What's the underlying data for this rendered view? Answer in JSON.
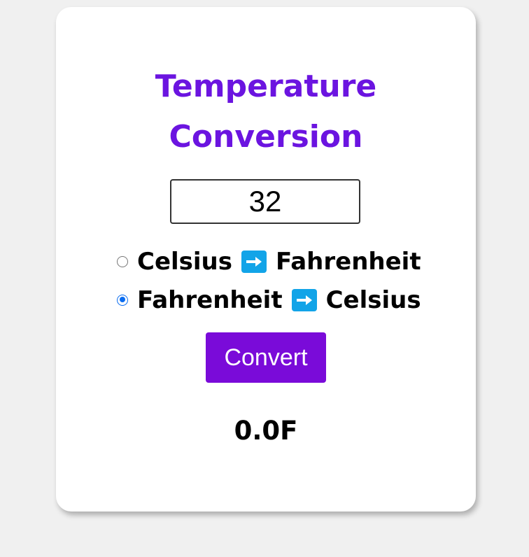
{
  "card": {
    "title_line1": "Temperature",
    "title_line2": "Conversion",
    "input": {
      "value": "32"
    },
    "options": [
      {
        "from": "Celsius",
        "to": "Fahrenheit",
        "selected": false
      },
      {
        "from": "Fahrenheit",
        "to": "Celsius",
        "selected": true
      }
    ],
    "arrow_icon": "right-arrow-icon",
    "convert_label": "Convert",
    "result": "0.0F"
  },
  "colors": {
    "title": "#6b14e0",
    "button": "#7a0bd9",
    "arrow_box": "#12a4e8",
    "radio_selected": "#0a6cf0"
  }
}
